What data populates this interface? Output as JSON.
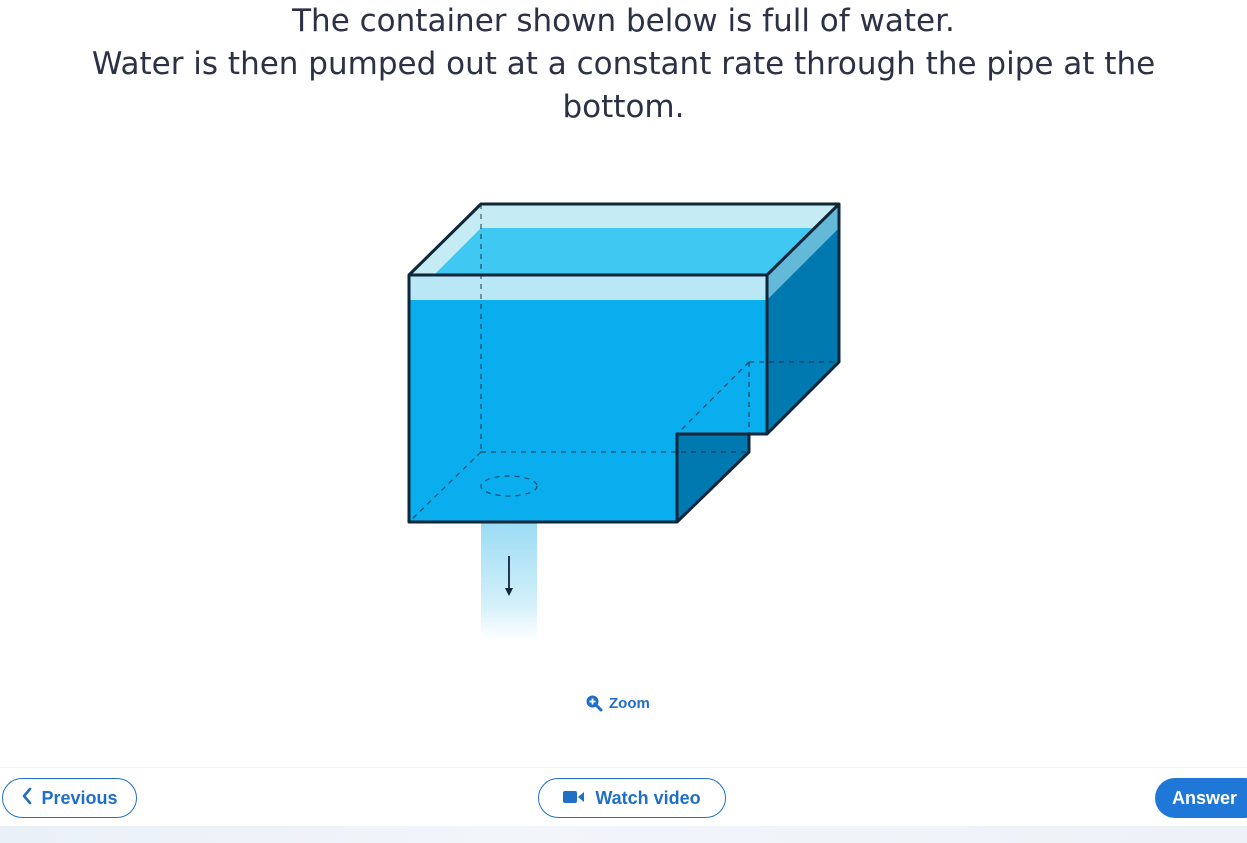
{
  "question": {
    "line1": "The container shown below is full of water.",
    "line2": "Water is then pumped out at a constant rate through the pipe at the",
    "line3": "bottom."
  },
  "diagram": {
    "description_icon": "water-container-diagram",
    "colors": {
      "water_front": "#0aaeee",
      "water_side": "#0078b0",
      "water_top": "#3fc8f2",
      "air": "#c5ecf4",
      "outline": "#10263a",
      "pipe_stream": "#b6e6f7"
    }
  },
  "zoom": {
    "label": "Zoom",
    "icon": "zoom-in-icon"
  },
  "nav": {
    "previous_label": "Previous",
    "previous_icon": "chevron-left-icon",
    "video_label": "Watch video",
    "video_icon": "video-camera-icon",
    "answer_label": "Answer"
  },
  "accent": "#1f6fc9"
}
